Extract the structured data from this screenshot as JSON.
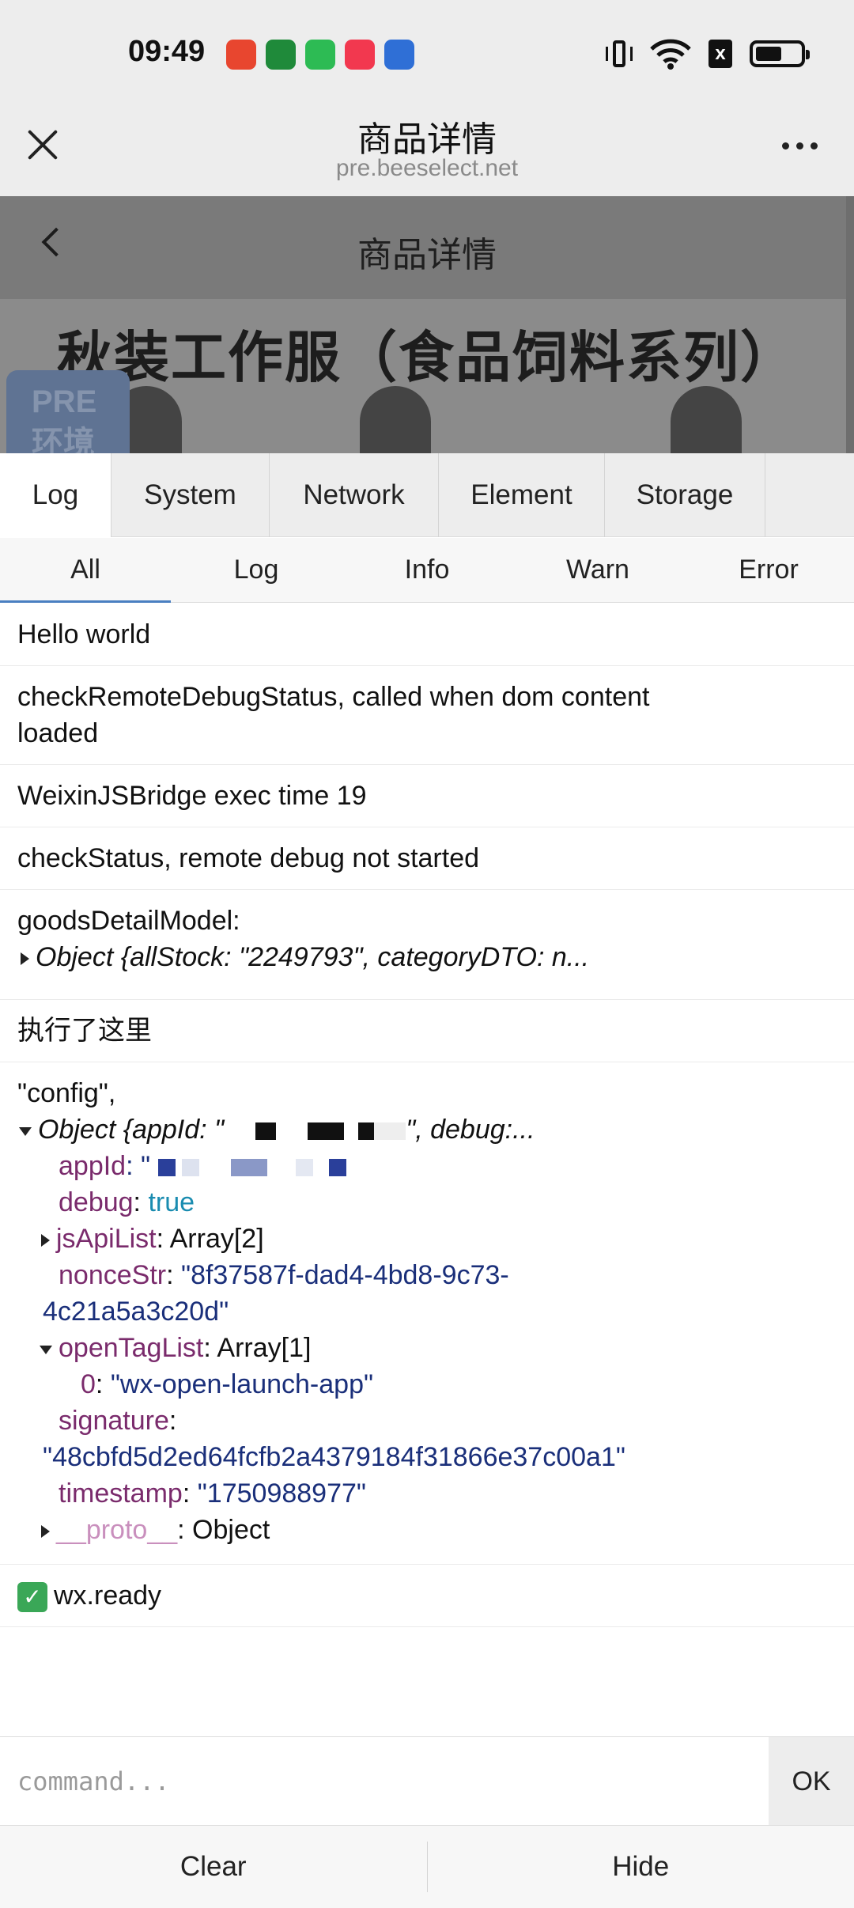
{
  "status_bar": {
    "time": "09:49",
    "app_icons": [
      {
        "name": "food-delivery-app-icon",
        "color": "#e8462f"
      },
      {
        "name": "oppo-app-icon",
        "color": "#1f8a3a"
      },
      {
        "name": "green-shopping-app-icon",
        "color": "#2dbb54"
      },
      {
        "name": "music-app-icon",
        "color": "#f2384f"
      },
      {
        "name": "baidu-app-icon",
        "color": "#2f6fd6"
      }
    ],
    "sim_label": "x"
  },
  "title_bar": {
    "title": "商品详情",
    "url": "pre.beeselect.net"
  },
  "webpage": {
    "nav_title": "商品详情",
    "banner_title": "秋装工作服（食品饲料系列）",
    "env_badge": [
      "PRE",
      "环境"
    ]
  },
  "console": {
    "tabs": [
      "Log",
      "System",
      "Network",
      "Element",
      "Storage"
    ],
    "active_tab": "Log",
    "subtabs": [
      "All",
      "Log",
      "Info",
      "Warn",
      "Error"
    ],
    "active_subtab": "All",
    "logs": {
      "l1": "Hello world",
      "l2": "checkRemoteDebugStatus, called when dom content loaded",
      "l3": "WeixinJSBridge exec time 19",
      "l4": "checkStatus, remote debug not started",
      "l5_label": "goodsDetailModel:",
      "l5_obj": "Object {allStock: \"2249793\", categoryDTO: n...",
      "l6": "执行了这里",
      "l7_label": "\"config\",",
      "l7_obj_prefix": "Object {appId: \"",
      "l7_obj_suffix": "\", debug:...",
      "appId_key": "appId",
      "appId_prefix": ": \"",
      "debug_key": "debug",
      "debug_val": "true",
      "jsApiList_key": "jsApiList",
      "jsApiList_val": ": Array[2]",
      "nonceStr_key": "nonceStr",
      "nonceStr_val_1": "\"8f37587f-dad4-4bd8-9c73-",
      "nonceStr_val_2": "4c21a5a3c20d\"",
      "openTagList_key": "openTagList",
      "openTagList_val": ": Array[1]",
      "openTag_0_key": "0",
      "openTag_0_val": "\"wx-open-launch-app\"",
      "signature_key": "signature",
      "signature_val": "\"48cbfd5d2ed64fcfb2a4379184f31866e37c00a1\"",
      "timestamp_key": "timestamp",
      "timestamp_val": "\"1750988977\"",
      "proto_key": "__proto__",
      "proto_val": ": Object",
      "l8": "wx.ready"
    },
    "command_placeholder": "command...",
    "ok_label": "OK",
    "clear_label": "Clear",
    "hide_label": "Hide"
  }
}
